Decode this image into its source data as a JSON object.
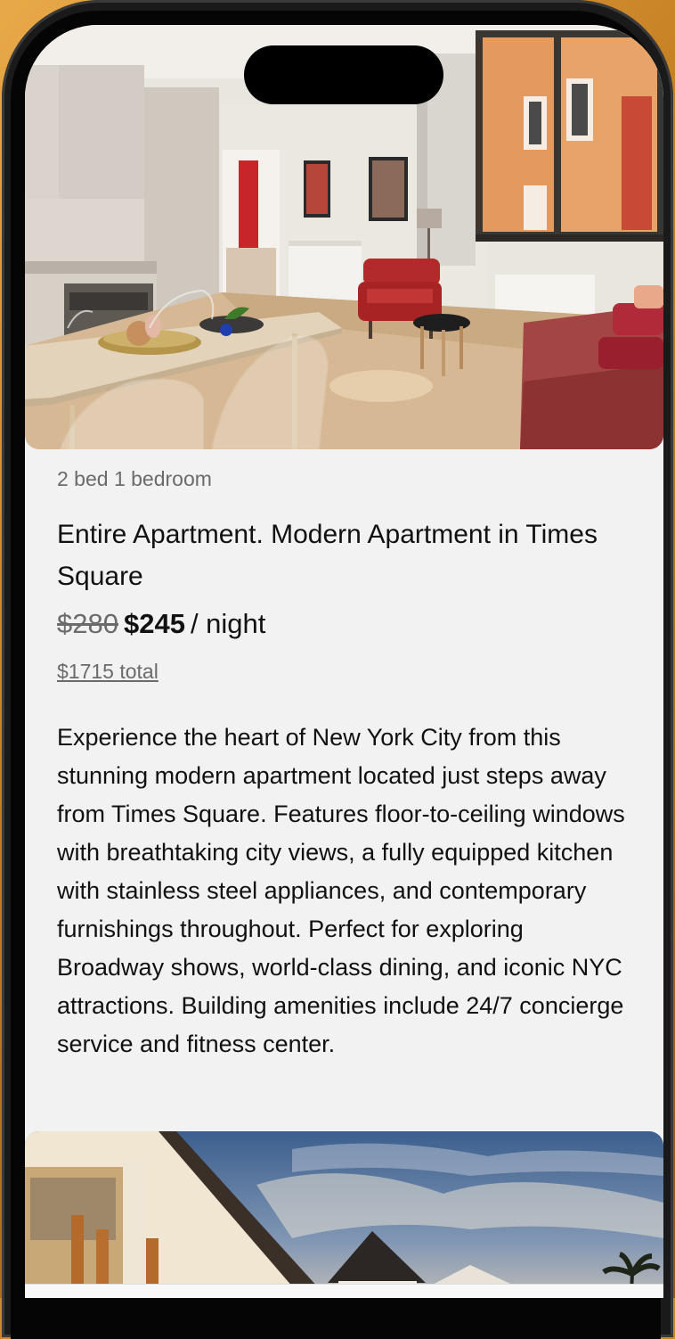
{
  "listing": {
    "beds": "2 bed 1 bedroom",
    "title": "Entire Apartment. Modern Apartment in Times Square",
    "price_old": "$280",
    "price_new": "$245",
    "price_unit": "/ night",
    "total": "$1715 total",
    "description": "Experience the heart of New York City from this stunning modern apartment located just steps away from Times Square. Features floor-to-ceiling windows with breathtaking city views, a fully equipped kitchen with stainless steel appliances, and contemporary furnishings throughout. Perfect for exploring Broadway shows, world-class dining, and iconic NYC attractions. Building amenities include 24/7 concierge service and fitness center."
  },
  "colors": {
    "background": "#f2f2f2",
    "text_primary": "#111111",
    "text_secondary": "#6b6b6b"
  }
}
